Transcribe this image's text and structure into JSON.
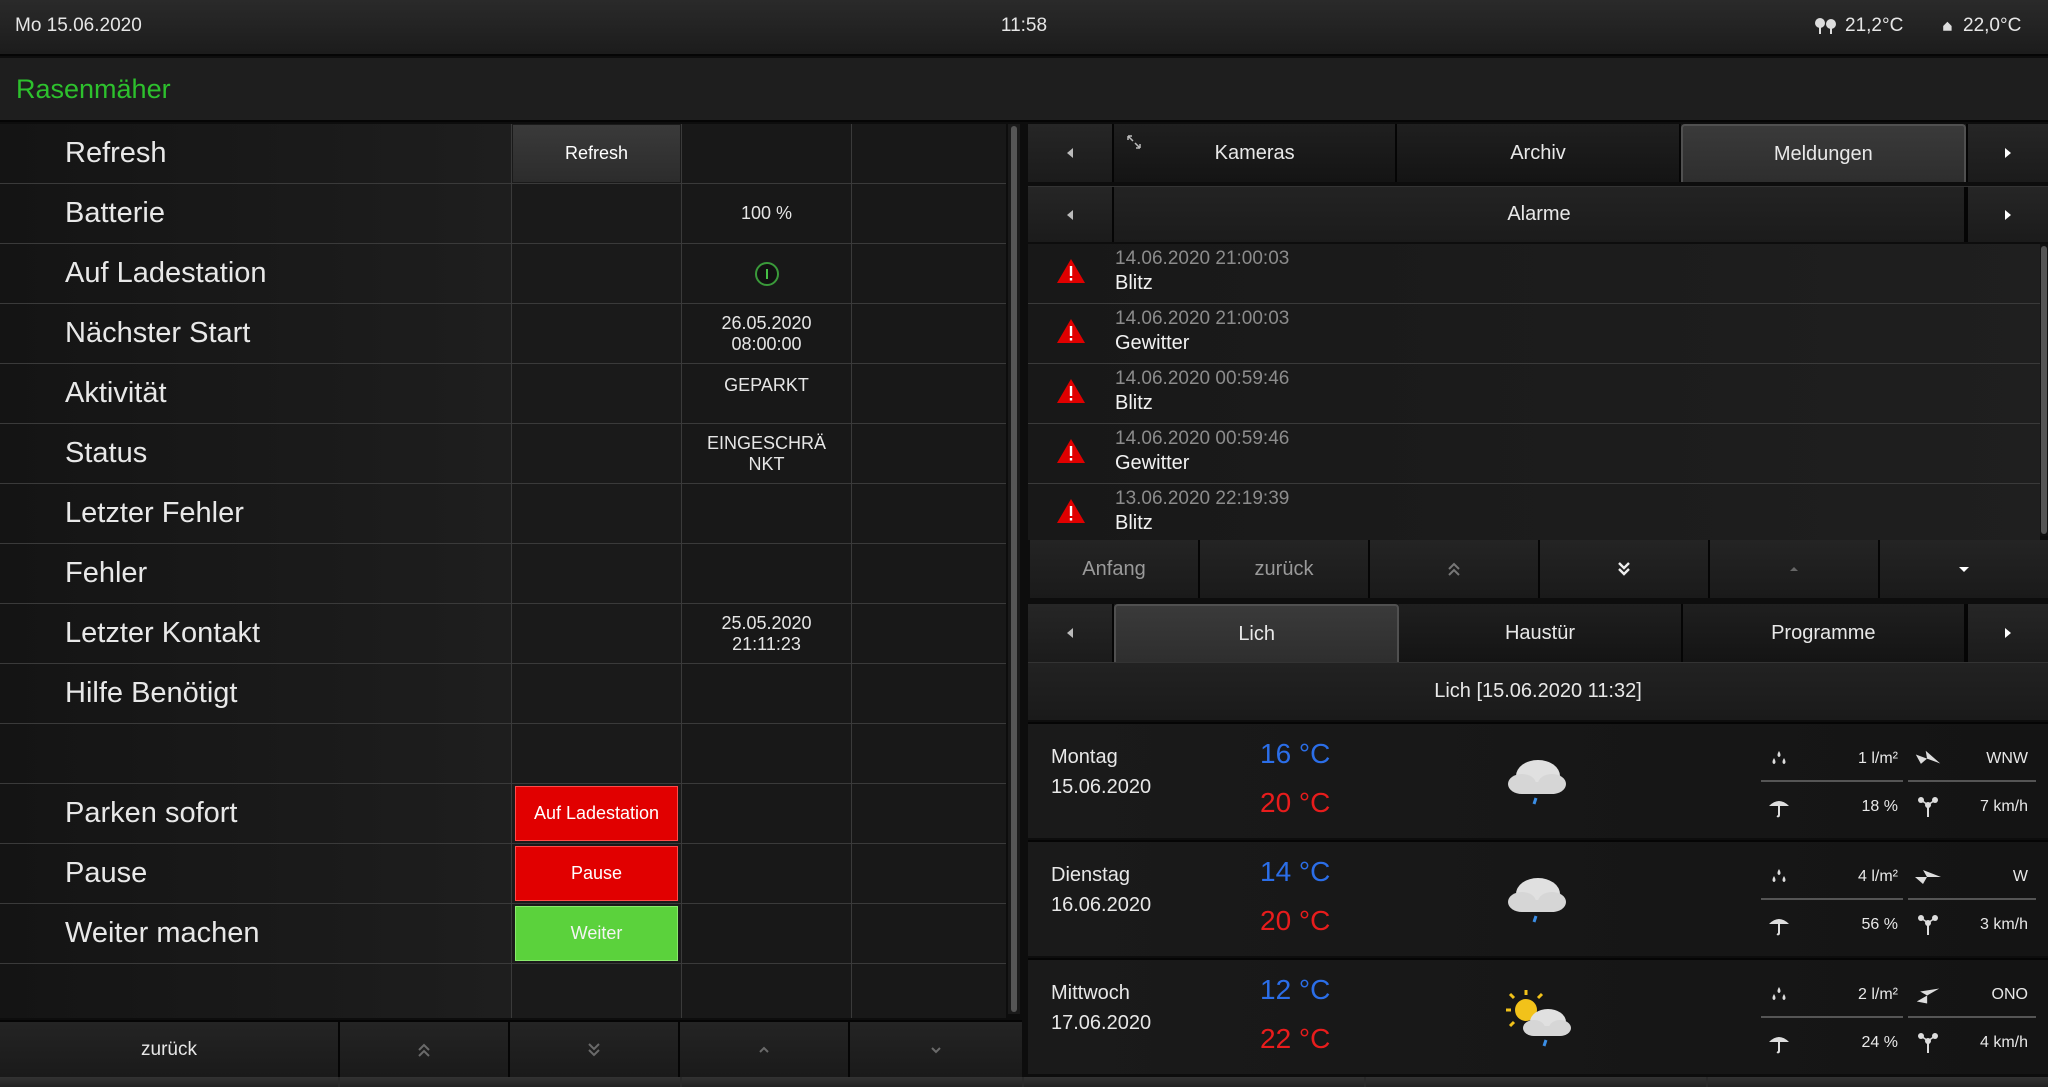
{
  "topbar": {
    "date": "Mo  15.06.2020",
    "time": "11:58",
    "outside_temp": "21,2°C",
    "inside_temp": "22,0°C",
    "outside_icon": "tree-icon",
    "inside_icon": "house-icon"
  },
  "page_title": "Rasenmäher",
  "left_table": {
    "rows": [
      {
        "label": "Refresh",
        "button": "Refresh",
        "value": ""
      },
      {
        "label": "Batterie",
        "value": "100 %"
      },
      {
        "label": "Auf Ladestation",
        "value": ""
      },
      {
        "label": "Nächster Start",
        "value1": "26.05.2020",
        "value2": "08:00:00"
      },
      {
        "label": "Aktivität",
        "value": "GEPARKT"
      },
      {
        "label": "Status",
        "value1": "EINGESCHRÄ",
        "value2": "NKT"
      },
      {
        "label": "Letzter Fehler",
        "value": ""
      },
      {
        "label": "Fehler",
        "value": ""
      },
      {
        "label": "Letzter Kontakt",
        "value1": "25.05.2020",
        "value2": "21:11:23"
      },
      {
        "label": "Hilfe Benötigt",
        "value": ""
      },
      {
        "label": "",
        "value": ""
      },
      {
        "label": "Parken sofort",
        "button": "Auf Ladestation"
      },
      {
        "label": "Pause",
        "button": "Pause"
      },
      {
        "label": "Weiter machen",
        "button": "Weiter"
      }
    ]
  },
  "left_nav": {
    "back": "zurück"
  },
  "tabs_top": [
    "Kameras",
    "Archiv",
    "Meldungen"
  ],
  "tabs_top_active": "Meldungen",
  "alarm_header": "Alarme",
  "alarms": [
    {
      "timestamp": "14.06.2020 21:00:03",
      "message": "Blitz"
    },
    {
      "timestamp": "14.06.2020 21:00:03",
      "message": "Gewitter"
    },
    {
      "timestamp": "14.06.2020 00:59:46",
      "message": "Blitz"
    },
    {
      "timestamp": "14.06.2020 00:59:46",
      "message": "Gewitter"
    },
    {
      "timestamp": "13.06.2020 22:19:39",
      "message": "Blitz"
    }
  ],
  "alarm_nav": {
    "first": "Anfang",
    "back": "zurück"
  },
  "tabs_bottom": [
    "Lich",
    "Haustür",
    "Programme"
  ],
  "tabs_bottom_active": "Lich",
  "weather_header": "Lich  [15.06.2020 11:32]",
  "forecast": [
    {
      "day": "Montag",
      "date": "15.06.2020",
      "tmin": "16 °C",
      "tmax": "20 °C",
      "icon": "rain-cloud-icon",
      "rain": "1 l/m²",
      "probability": "18 %",
      "direction": "WNW",
      "wind": "7 km/h"
    },
    {
      "day": "Dienstag",
      "date": "16.06.2020",
      "tmin": "14 °C",
      "tmax": "20 °C",
      "icon": "rain-cloud-icon",
      "rain": "4 l/m²",
      "probability": "56 %",
      "direction": "W",
      "wind": "3 km/h"
    },
    {
      "day": "Mittwoch",
      "date": "17.06.2020",
      "tmin": "12 °C",
      "tmax": "22 °C",
      "icon": "sun-cloud-rain-icon",
      "rain": "2 l/m²",
      "probability": "24 %",
      "direction": "ONO",
      "wind": "4 km/h"
    }
  ],
  "colors": {
    "title": "#2dc12d",
    "alarm_red": "#e00000",
    "button_red": "#e10000",
    "button_green": "#5bd23c",
    "temp_min": "#2b6ee8",
    "temp_max": "#e81c1c"
  }
}
